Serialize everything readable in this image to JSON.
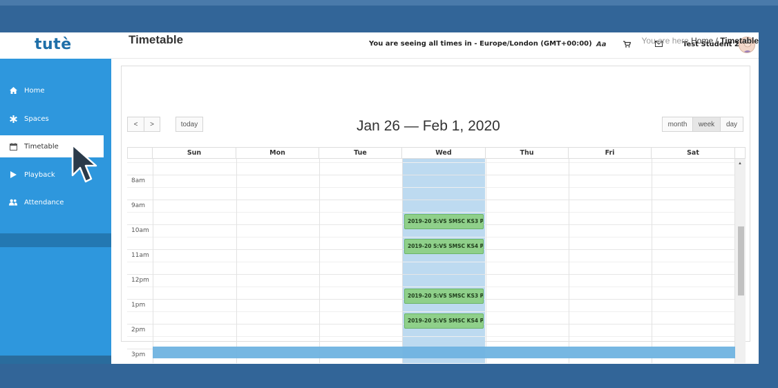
{
  "app": {
    "logo": "tutè"
  },
  "topbar": {
    "timezone_text": "You are seeing all times in - Europe/London (GMT+00:00)",
    "font_icon_label": "Aa",
    "user_name": "Test Student 2"
  },
  "sidebar": {
    "items": [
      {
        "label": "Home",
        "icon": "home-icon"
      },
      {
        "label": "Spaces",
        "icon": "asterisk-icon"
      },
      {
        "label": "Timetable",
        "icon": "calendar-icon"
      },
      {
        "label": "Playback",
        "icon": "play-icon"
      },
      {
        "label": "Attendance",
        "icon": "users-icon"
      }
    ]
  },
  "page": {
    "title": "Timetable",
    "breadcrumb_prefix": "You are here",
    "breadcrumb_home": "Home",
    "breadcrumb_sep": "/",
    "breadcrumb_current": "Timetable"
  },
  "calendar": {
    "prev_label": "<",
    "next_label": ">",
    "today_label": "today",
    "range_title": "Jan 26 — Feb 1, 2020",
    "views": [
      "month",
      "week",
      "day"
    ],
    "active_view": "week",
    "days": [
      "Sun",
      "Mon",
      "Tue",
      "Wed",
      "Thu",
      "Fri",
      "Sat"
    ],
    "times": [
      "8am",
      "9am",
      "10am",
      "11am",
      "12pm",
      "1pm",
      "2pm",
      "3pm"
    ],
    "events": [
      {
        "title": "2019-20 S:VS SMSC KS3 P"
      },
      {
        "title": "2019-20 S:VS SMSC KS4 P"
      },
      {
        "title": "2019-20 S:VS SMSC KS3 P"
      },
      {
        "title": "2019-20 S:VS SMSC KS4 P"
      }
    ]
  },
  "colors": {
    "background": "#326598",
    "sidebar": "#2e97dd",
    "today_column": "#bddaf0",
    "event": "#8fd08a",
    "now_band": "#6fb3e0"
  }
}
